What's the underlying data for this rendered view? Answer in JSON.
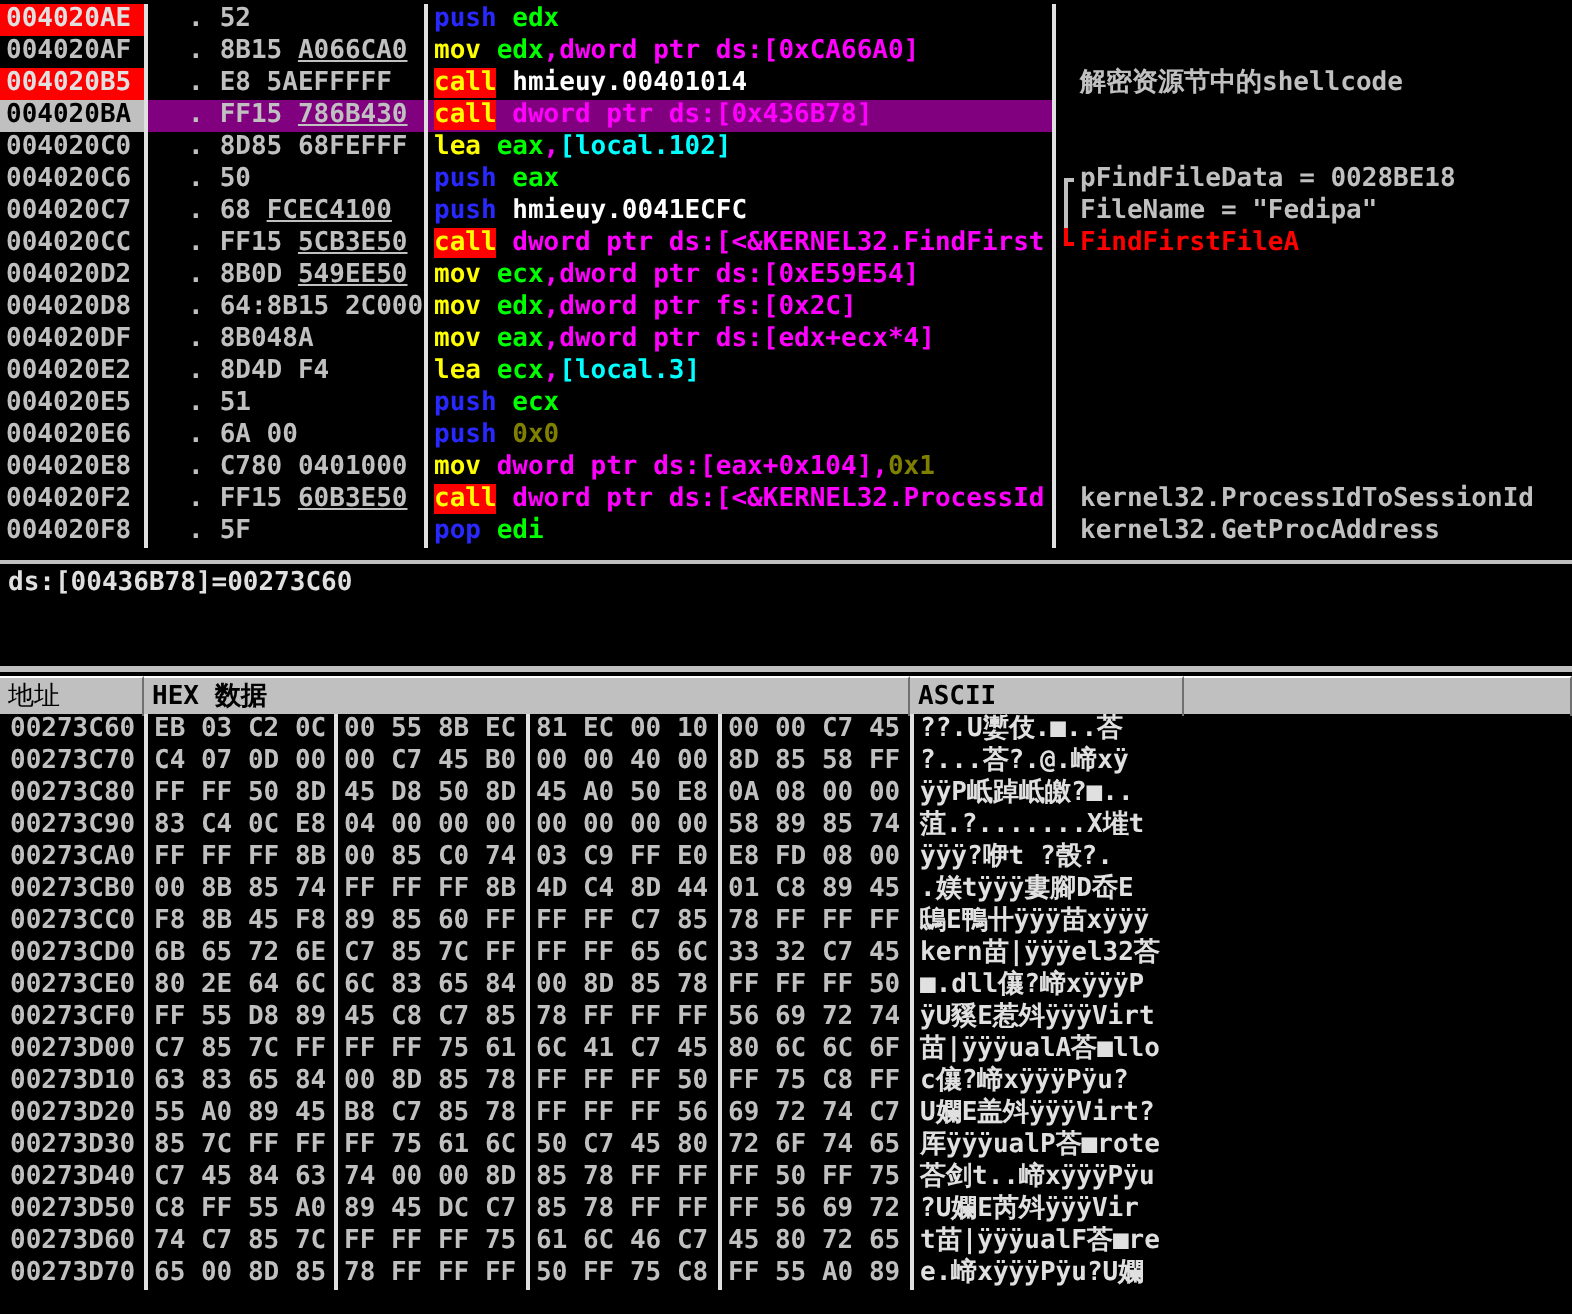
{
  "disassembly": {
    "rows": [
      {
        "address": "004020AE",
        "breakpoint": true,
        "selected": false,
        "flow": ".",
        "hex": "52",
        "mnemonic": "push",
        "kind": "stack",
        "operands": [
          {
            "text": "edx",
            "kind": "reg"
          }
        ]
      },
      {
        "address": "004020AF",
        "breakpoint": false,
        "selected": false,
        "flow": ".",
        "hex": "8B15",
        "hex_ref": "A066CA0",
        "mnemonic": "mov",
        "kind": "data",
        "operands": [
          {
            "text": "edx",
            "kind": "reg"
          },
          {
            "text": ",",
            "kind": "punct"
          },
          {
            "text": "dword ptr ds:[0xCA66A0]",
            "kind": "mem"
          }
        ]
      },
      {
        "address": "004020B5",
        "breakpoint": true,
        "selected": false,
        "flow": ".",
        "hex": "E8 5AEFFFFF",
        "mnemonic": "call",
        "kind": "call",
        "operands": [
          {
            "text": "hmieuy.00401014",
            "kind": "label"
          }
        ],
        "comment": {
          "text": "解密资源节中的shellcode",
          "highlight": false
        }
      },
      {
        "address": "004020BA",
        "breakpoint": false,
        "selected": true,
        "flow": ".",
        "hex": "FF15",
        "hex_ref": "786B430",
        "mnemonic": "call",
        "kind": "call",
        "operands": [
          {
            "text": "dword ptr ds:[0x436B78]",
            "kind": "mem"
          }
        ]
      },
      {
        "address": "004020C0",
        "breakpoint": false,
        "selected": false,
        "flow": ".",
        "hex": "8D85 68FEFFF",
        "mnemonic": "lea",
        "kind": "data",
        "operands": [
          {
            "text": "eax",
            "kind": "reg"
          },
          {
            "text": ",",
            "kind": "punct"
          },
          {
            "text": "[local.102]",
            "kind": "local"
          }
        ]
      },
      {
        "address": "004020C6",
        "breakpoint": false,
        "selected": false,
        "flow": ".",
        "hex": "50",
        "mnemonic": "push",
        "kind": "stack",
        "operands": [
          {
            "text": "eax",
            "kind": "reg"
          }
        ],
        "comment": {
          "text": "pFindFileData = 0028BE18",
          "highlight": false,
          "kind": "bracket_top"
        }
      },
      {
        "address": "004020C7",
        "breakpoint": false,
        "selected": false,
        "flow": ".",
        "hex": "68",
        "hex_ref": "FCEC4100",
        "mnemonic": "push",
        "kind": "stack",
        "operands": [
          {
            "text": "hmieuy.0041ECFC",
            "kind": "label"
          }
        ],
        "comment": {
          "text": "FileName = \"Fedipa\"",
          "highlight": false,
          "kind": "bracket_middle"
        }
      },
      {
        "address": "004020CC",
        "breakpoint": false,
        "selected": false,
        "flow": ".",
        "hex": "FF15",
        "hex_ref": "5CB3E50",
        "mnemonic": "call",
        "kind": "call",
        "operands": [
          {
            "text": "dword ptr ds:[<&KERNEL32.FindFirst",
            "kind": "mem"
          }
        ],
        "comment": {
          "text": "FindFirstFileA",
          "highlight": true,
          "kind": "bracket_bottom"
        }
      },
      {
        "address": "004020D2",
        "breakpoint": false,
        "selected": false,
        "flow": ".",
        "hex": "8B0D",
        "hex_ref": "549EE50",
        "mnemonic": "mov",
        "kind": "data",
        "operands": [
          {
            "text": "ecx",
            "kind": "reg"
          },
          {
            "text": ",",
            "kind": "punct"
          },
          {
            "text": "dword ptr ds:[0xE59E54]",
            "kind": "mem"
          }
        ]
      },
      {
        "address": "004020D8",
        "breakpoint": false,
        "selected": false,
        "flow": ".",
        "hex": "64:8B15 2C000",
        "mnemonic": "mov",
        "kind": "data",
        "operands": [
          {
            "text": "edx",
            "kind": "reg"
          },
          {
            "text": ",",
            "kind": "punct"
          },
          {
            "text": "dword ptr fs:[0x2C]",
            "kind": "mem"
          }
        ]
      },
      {
        "address": "004020DF",
        "breakpoint": false,
        "selected": false,
        "flow": ".",
        "hex": "8B048A",
        "mnemonic": "mov",
        "kind": "data",
        "operands": [
          {
            "text": "eax",
            "kind": "reg"
          },
          {
            "text": ",",
            "kind": "punct"
          },
          {
            "text": "dword ptr ds:[edx+ecx*4]",
            "kind": "mem"
          }
        ]
      },
      {
        "address": "004020E2",
        "breakpoint": false,
        "selected": false,
        "flow": ".",
        "hex": "8D4D F4",
        "mnemonic": "lea",
        "kind": "data",
        "operands": [
          {
            "text": "ecx",
            "kind": "reg"
          },
          {
            "text": ",",
            "kind": "punct"
          },
          {
            "text": "[local.3]",
            "kind": "local"
          }
        ]
      },
      {
        "address": "004020E5",
        "breakpoint": false,
        "selected": false,
        "flow": ".",
        "hex": "51",
        "mnemonic": "push",
        "kind": "stack",
        "operands": [
          {
            "text": "ecx",
            "kind": "reg"
          }
        ]
      },
      {
        "address": "004020E6",
        "breakpoint": false,
        "selected": false,
        "flow": ".",
        "hex": "6A 00",
        "mnemonic": "push",
        "kind": "stack",
        "operands": [
          {
            "text": "0x0",
            "kind": "const"
          }
        ]
      },
      {
        "address": "004020E8",
        "breakpoint": false,
        "selected": false,
        "flow": ".",
        "hex": "C780 0401000",
        "mnemonic": "mov",
        "kind": "data",
        "operands": [
          {
            "text": "dword ptr ds:[eax+0x104],",
            "kind": "mem"
          },
          {
            "text": "0x1",
            "kind": "const"
          }
        ]
      },
      {
        "address": "004020F2",
        "breakpoint": false,
        "selected": false,
        "flow": ".",
        "hex": "FF15",
        "hex_ref": "60B3E50",
        "mnemonic": "call",
        "kind": "call",
        "operands": [
          {
            "text": "dword ptr ds:[<&KERNEL32.ProcessId",
            "kind": "mem"
          }
        ],
        "comment": {
          "text": "kernel32.ProcessIdToSessionId",
          "highlight": false
        }
      },
      {
        "address": "004020F8",
        "breakpoint": false,
        "selected": false,
        "flow": ".",
        "hex": "5F",
        "mnemonic": "pop",
        "kind": "stack",
        "operands": [
          {
            "text": "edi",
            "kind": "reg"
          }
        ],
        "comment": {
          "text": "kernel32.GetProcAddress",
          "highlight": false
        }
      }
    ]
  },
  "info": {
    "text": "ds:[00436B78]=00273C60"
  },
  "dump": {
    "columns": [
      "地址",
      "HEX 数据",
      "ASCII"
    ],
    "rows": [
      {
        "address": "00273C60",
        "groups": [
          "EB 03 C2 0C",
          "00 55 8B EC",
          "81 EC 00 10",
          "00 00 C7 45"
        ],
        "ascii": "??.U嬱伎.■..荅"
      },
      {
        "address": "00273C70",
        "groups": [
          "C4 07 0D 00",
          "00 C7 45 B0",
          "00 00 40 00",
          "8D 85 58 FF"
        ],
        "ascii": "?...荅?.@.崹xÿ"
      },
      {
        "address": "00273C80",
        "groups": [
          "FF FF 50 8D",
          "45 D8 50 8D",
          "45 A0 50 E8",
          "0A 08 00 00"
        ],
        "ascii": "ÿÿP岻踔岻皦?■.."
      },
      {
        "address": "00273C90",
        "groups": [
          "83 C4 0C E8",
          "04 00 00 00",
          "00 00 00 00",
          "58 89 85 74"
        ],
        "ascii": "菹.?.......X墔t"
      },
      {
        "address": "00273CA0",
        "groups": [
          "FF FF FF 8B",
          "00 85 C0 74",
          "03 C9 FF E0",
          "E8 FD 08 00"
        ],
        "ascii": "ÿÿÿ?咿t ?嗀?."
      },
      {
        "address": "00273CB0",
        "groups": [
          "00 8B 85 74",
          "FF FF FF 8B",
          "4D C4 8D 44",
          "01 C8 89 45"
        ],
        "ascii": ".媄tÿÿÿ婁腳D岙E"
      },
      {
        "address": "00273CC0",
        "groups": [
          "F8 8B 45 F8",
          "89 85 60 FF",
          "FF FF C7 85",
          "78 FF FF FF"
        ],
        "ascii": "鴟E鴨卄ÿÿÿ苗xÿÿÿ"
      },
      {
        "address": "00273CD0",
        "groups": [
          "6B 65 72 6E",
          "C7 85 7C FF",
          "FF FF 65 6C",
          "33 32 C7 45"
        ],
        "ascii": "kern苗|ÿÿÿel32荅"
      },
      {
        "address": "00273CE0",
        "groups": [
          "80 2E 64 6C",
          "6C 83 65 84",
          "00 8D 85 78",
          "FF FF FF 50"
        ],
        "ascii": "■.dll儴?崹xÿÿÿP"
      },
      {
        "address": "00273CF0",
        "groups": [
          "FF 55 D8 89",
          "45 C8 C7 85",
          "78 FF FF FF",
          "56 69 72 74"
        ],
        "ascii": "ÿU豯E惹斘ÿÿÿVirt"
      },
      {
        "address": "00273D00",
        "groups": [
          "C7 85 7C FF",
          "FF FF 75 61",
          "6C 41 C7 45",
          "80 6C 6C 6F"
        ],
        "ascii": "苗|ÿÿÿualA荅■llo"
      },
      {
        "address": "00273D10",
        "groups": [
          "63 83 65 84",
          "00 8D 85 78",
          "FF FF FF 50",
          "FF 75 C8 FF"
        ],
        "ascii": "c儴?崹xÿÿÿPÿu?"
      },
      {
        "address": "00273D20",
        "groups": [
          "55 A0 89 45",
          "B8 C7 85 78",
          "FF FF FF 56",
          "69 72 74 C7"
        ],
        "ascii": "U孄E盖斘ÿÿÿVirt?"
      },
      {
        "address": "00273D30",
        "groups": [
          "85 7C FF FF",
          "FF 75 61 6C",
          "50 C7 45 80",
          "72 6F 74 65"
        ],
        "ascii": "厍ÿÿÿualP荅■rote"
      },
      {
        "address": "00273D40",
        "groups": [
          "C7 45 84 63",
          "74 00 00 8D",
          "85 78 FF FF",
          "FF 50 FF 75"
        ],
        "ascii": "荅剑t..崹xÿÿÿPÿu"
      },
      {
        "address": "00273D50",
        "groups": [
          "C8 FF 55 A0",
          "89 45 DC C7",
          "85 78 FF FF",
          "FF 56 69 72"
        ],
        "ascii": "?U孄E芮斘ÿÿÿVir"
      },
      {
        "address": "00273D60",
        "groups": [
          "74 C7 85 7C",
          "FF FF FF 75",
          "61 6C 46 C7",
          "45 80 72 65"
        ],
        "ascii": "t苗|ÿÿÿualF荅■re"
      },
      {
        "address": "00273D70",
        "groups": [
          "65 00 8D 85",
          "78 FF FF FF",
          "50 FF 75 C8",
          "FF 55 A0 89"
        ],
        "ascii": "e.崹xÿÿÿPÿu?U孄"
      }
    ]
  }
}
